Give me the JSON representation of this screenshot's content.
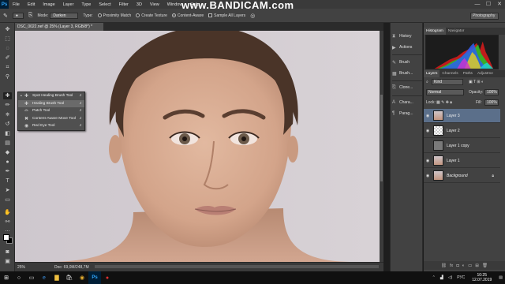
{
  "app": {
    "logo": "Ps",
    "watermark": "www.BANDICAM.com",
    "menus": [
      "File",
      "Edit",
      "Image",
      "Layer",
      "Type",
      "Select",
      "Filter",
      "3D",
      "View",
      "Window",
      "Help"
    ],
    "window_controls": [
      "—",
      "☐",
      "✕"
    ]
  },
  "options": {
    "mode_label": "Mode:",
    "mode_value": "Darken",
    "type_label": "Type:",
    "proximity": "Proximity Match",
    "texture": "Create Texture",
    "content_aware": "Content-Aware",
    "sample_all": "Sample All Layers",
    "workspace": "Photography"
  },
  "document": {
    "tab_title": "DSC_0022.nef @ 25% (Layer 3, RGB/8*) *",
    "zoom": "25%",
    "doc_info": "Doc: 69,0M/248,7M"
  },
  "flyout": {
    "items": [
      {
        "label": "Spot Healing Brush Tool",
        "key": "J",
        "selected": false,
        "icon": "spot-healing-icon"
      },
      {
        "label": "Healing Brush Tool",
        "key": "J",
        "selected": true,
        "icon": "healing-brush-icon"
      },
      {
        "label": "Patch Tool",
        "key": "J",
        "selected": false,
        "icon": "patch-icon"
      },
      {
        "label": "Content-Aware Move Tool",
        "key": "J",
        "selected": false,
        "icon": "content-aware-move-icon"
      },
      {
        "label": "Red Eye Tool",
        "key": "J",
        "selected": false,
        "icon": "red-eye-icon"
      }
    ]
  },
  "collapsed_panels": {
    "items": [
      "History",
      "Actions",
      "Brush",
      "Brush...",
      "Clone...",
      "Chara...",
      "Parag..."
    ]
  },
  "histogram": {
    "tabs": [
      "Histogram",
      "Navigator"
    ]
  },
  "layers_panel": {
    "tabs": [
      "Layers",
      "Channels",
      "Paths",
      "Adjustme"
    ],
    "kind": "Kind",
    "blend_mode": "Normal",
    "opacity_label": "Opacity:",
    "opacity": "100%",
    "lock_label": "Lock:",
    "fill_label": "Fill:",
    "fill": "100%",
    "layers": [
      {
        "name": "Layer 3",
        "selected": true,
        "visible": true,
        "italic": false,
        "thumb": "photo"
      },
      {
        "name": "Layer 2",
        "selected": false,
        "visible": true,
        "italic": false,
        "thumb": "checker"
      },
      {
        "name": "Layer 1 copy",
        "selected": false,
        "visible": false,
        "italic": false,
        "thumb": "gray"
      },
      {
        "name": "Layer 1",
        "selected": false,
        "visible": true,
        "italic": false,
        "thumb": "photo"
      },
      {
        "name": "Background",
        "selected": false,
        "visible": true,
        "italic": true,
        "thumb": "photo"
      }
    ],
    "footer_icons": [
      "link-icon",
      "fx-icon",
      "mask-icon",
      "adjustment-icon",
      "folder-icon",
      "new-layer-icon",
      "trash-icon"
    ]
  },
  "taskbar": {
    "lang": "РУС",
    "time": "10:25",
    "date": "12.07.2019"
  }
}
